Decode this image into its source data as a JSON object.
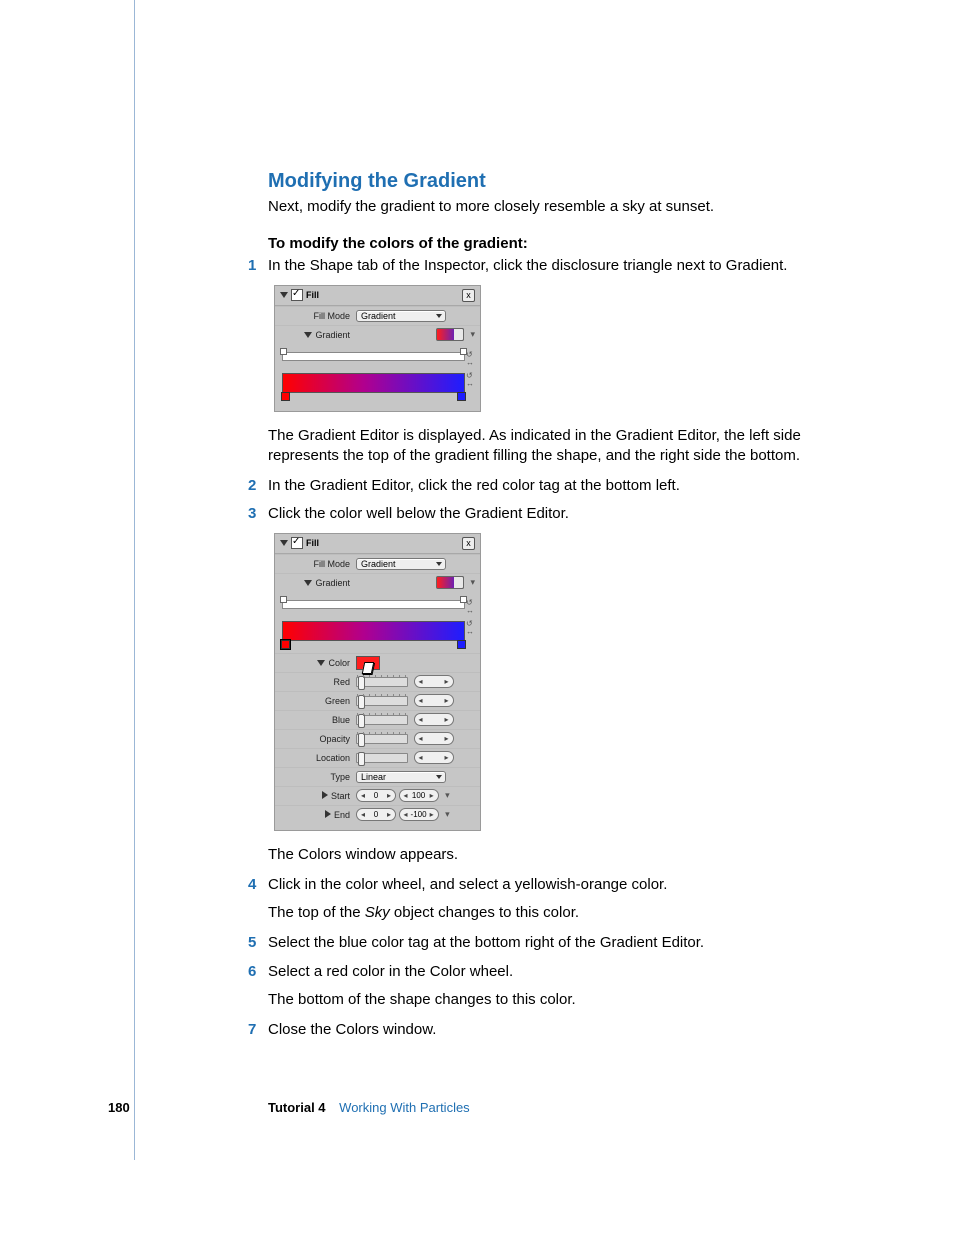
{
  "page_number": "180",
  "footer_label": "Tutorial 4",
  "footer_title": "Working With Particles",
  "heading": "Modifying the Gradient",
  "intro": "Next, modify the gradient to more closely resemble a sky at sunset.",
  "subhead": "To modify the colors of the gradient:",
  "steps": {
    "s1": "In the Shape tab of the Inspector, click the disclosure triangle next to Gradient.",
    "after1": "The Gradient Editor is displayed. As indicated in the Gradient Editor, the left side represents the top of the gradient filling the shape, and the right side the bottom.",
    "s2": "In the Gradient Editor, click the red color tag at the bottom left.",
    "s3": "Click the color well below the Gradient Editor.",
    "after3": "The Colors window appears.",
    "s4": "Click in the color wheel, and select a yellowish-orange color.",
    "after4a": "The top of the ",
    "after4b_italic": "Sky",
    "after4c": " object changes to this color.",
    "s5": "Select the blue color tag at the bottom right of the Gradient Editor.",
    "s6": "Select a red color in the Color wheel.",
    "after6": "The bottom of the shape changes to this color.",
    "s7": "Close the Colors window."
  },
  "panel": {
    "title": "Fill",
    "close": "x",
    "fill_mode_label": "Fill Mode",
    "fill_mode_value": "Gradient",
    "gradient_label": "Gradient",
    "color_label": "Color",
    "red_label": "Red",
    "green_label": "Green",
    "blue_label": "Blue",
    "opacity_label": "Opacity",
    "location_label": "Location",
    "type_label": "Type",
    "type_value": "Linear",
    "start_label": "Start",
    "end_label": "End",
    "vals": {
      "zero": "0",
      "hundred": "100",
      "neg_hundred": "-100"
    }
  }
}
